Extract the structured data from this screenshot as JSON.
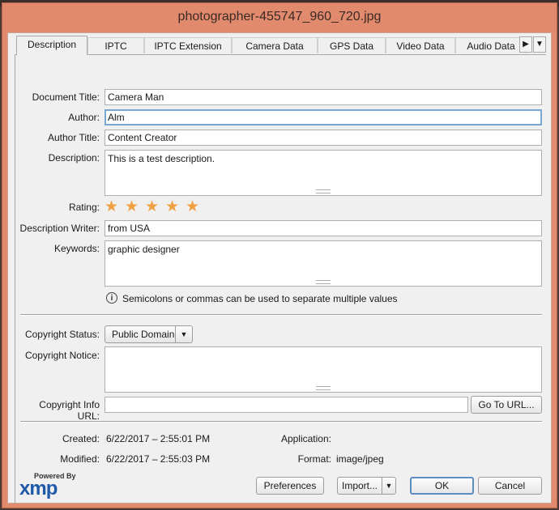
{
  "window": {
    "title": "photographer-455747_960_720.jpg"
  },
  "tabs": [
    {
      "label": "Description"
    },
    {
      "label": "IPTC"
    },
    {
      "label": "IPTC Extension"
    },
    {
      "label": "Camera Data"
    },
    {
      "label": "GPS Data"
    },
    {
      "label": "Video Data"
    },
    {
      "label": "Audio Data"
    }
  ],
  "tab_scroll_icon": "triangle-right-icon",
  "tab_menu_icon": "chevron-down-icon",
  "description": {
    "document_title_label": "Document Title:",
    "document_title": "Camera Man",
    "author_label": "Author:",
    "author": "Alm",
    "author_title_label": "Author Title:",
    "author_title": "Content Creator",
    "description_label": "Description:",
    "description": "This is a test description.",
    "rating_label": "Rating:",
    "rating": 5,
    "rating_max": 5,
    "rating_color": "#f0a040",
    "description_writer_label": "Description Writer:",
    "description_writer": "from USA",
    "keywords_label": "Keywords:",
    "keywords": "graphic designer",
    "keywords_hint": "Semicolons or commas can be used to separate multiple values",
    "hint_icon": "info-icon"
  },
  "copyright": {
    "status_label": "Copyright Status:",
    "status_value": "Public Domain",
    "notice_label": "Copyright Notice:",
    "notice": "",
    "info_url_label": "Copyright Info URL:",
    "info_url": "",
    "goto_url_button": "Go To URL..."
  },
  "file_info": {
    "created_label": "Created:",
    "created": "6/22/2017 – 2:55:01 PM",
    "modified_label": "Modified:",
    "modified": "6/22/2017 – 2:55:03 PM",
    "application_label": "Application:",
    "application": "",
    "format_label": "Format:",
    "format": "image/jpeg"
  },
  "footer": {
    "powered_by": "Powered By",
    "logo_text": "xmp",
    "preferences_button": "Preferences",
    "import_button": "Import...",
    "ok_button": "OK",
    "cancel_button": "Cancel"
  }
}
